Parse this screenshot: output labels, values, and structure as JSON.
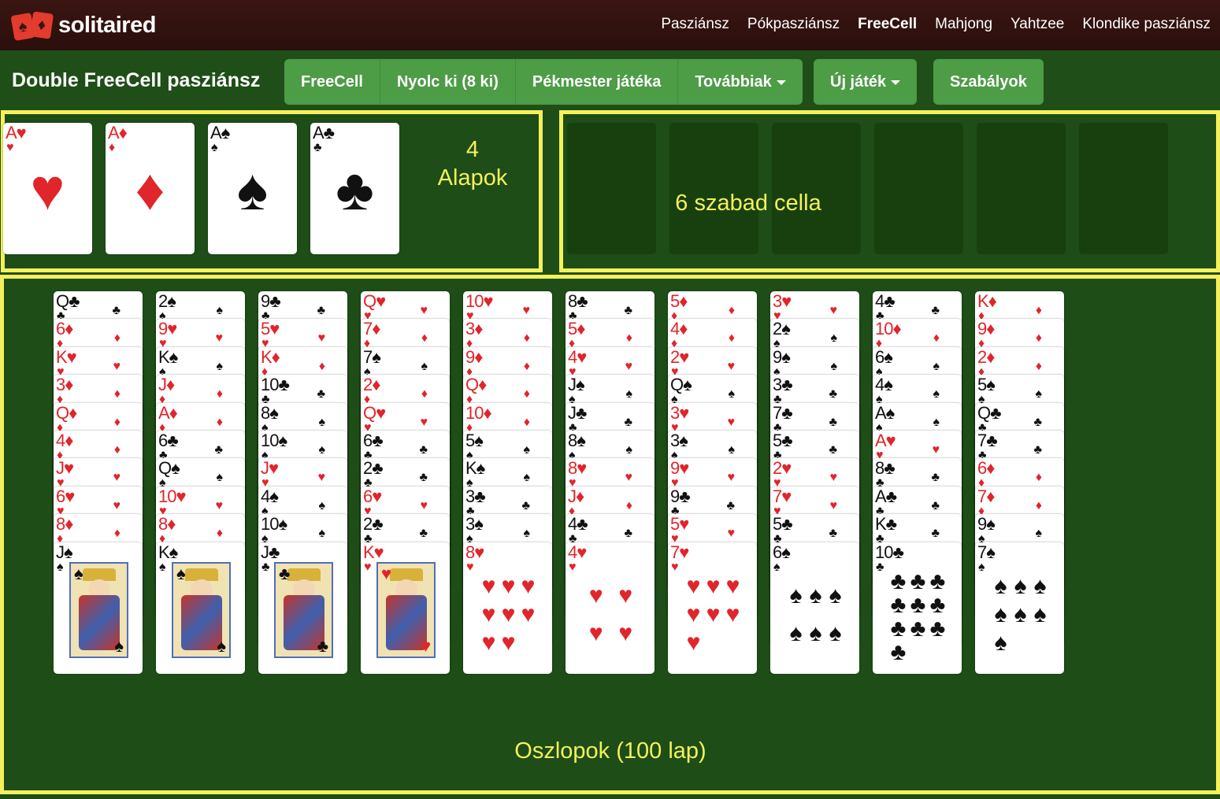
{
  "header": {
    "logo_text": "solitaired",
    "nav": [
      "Pasziánsz",
      "Pókpasziánsz",
      "FreeCell",
      "Mahjong",
      "Yahtzee",
      "Klondike pasziánsz"
    ],
    "nav_active": "FreeCell"
  },
  "toolbar": {
    "title": "Double FreeCell pasziánsz",
    "variants": [
      "FreeCell",
      "Nyolc ki (8 ki)",
      "Pékmester játéka",
      "Továbbiak"
    ],
    "new_game": "Új játék",
    "rules": "Szabályok"
  },
  "annotations": {
    "foundations_count": "4",
    "foundations_label": "Alapok",
    "freecells_label": "6 szabad cella",
    "columns_label": "Oszlopok (100 lap)"
  },
  "foundations": [
    {
      "rank": "A",
      "suit": "♥",
      "color": "red"
    },
    {
      "rank": "A",
      "suit": "♦",
      "color": "red"
    },
    {
      "rank": "A",
      "suit": "♠",
      "color": "black"
    },
    {
      "rank": "A",
      "suit": "♣",
      "color": "black"
    }
  ],
  "free_cells": 6,
  "columns": [
    [
      "Q♣",
      "6♦",
      "K♥",
      "3♦",
      "Q♦",
      "4♦",
      "J♥",
      "6♥",
      "8♦",
      "J♠"
    ],
    [
      "2♠",
      "9♥",
      "K♠",
      "J♦",
      "A♦",
      "6♣",
      "Q♠",
      "10♥",
      "8♦",
      "K♠"
    ],
    [
      "9♣",
      "5♥",
      "K♦",
      "10♣",
      "8♠",
      "10♠",
      "J♥",
      "4♠",
      "10♠",
      "J♣"
    ],
    [
      "Q♥",
      "7♦",
      "7♠",
      "2♦",
      "Q♥",
      "6♣",
      "2♣",
      "6♥",
      "2♣",
      "K♥"
    ],
    [
      "10♥",
      "3♦",
      "9♦",
      "Q♦",
      "10♦",
      "5♠",
      "K♠",
      "3♣",
      "3♠",
      "8♥"
    ],
    [
      "8♣",
      "5♦",
      "4♥",
      "J♠",
      "J♣",
      "8♠",
      "8♥",
      "J♦",
      "4♣",
      "4♥"
    ],
    [
      "5♦",
      "4♦",
      "2♥",
      "Q♠",
      "3♥",
      "3♠",
      "9♥",
      "9♣",
      "5♥",
      "7♥"
    ],
    [
      "3♥",
      "2♠",
      "9♠",
      "3♣",
      "7♣",
      "5♣",
      "2♥",
      "7♥",
      "5♣",
      "6♠"
    ],
    [
      "4♣",
      "10♦",
      "6♠",
      "4♠",
      "A♠",
      "A♥",
      "8♣",
      "A♣",
      "K♣",
      "10♣"
    ],
    [
      "K♦",
      "9♦",
      "2♦",
      "5♠",
      "Q♣",
      "7♣",
      "6♦",
      "7♦",
      "9♠",
      "7♠"
    ]
  ]
}
